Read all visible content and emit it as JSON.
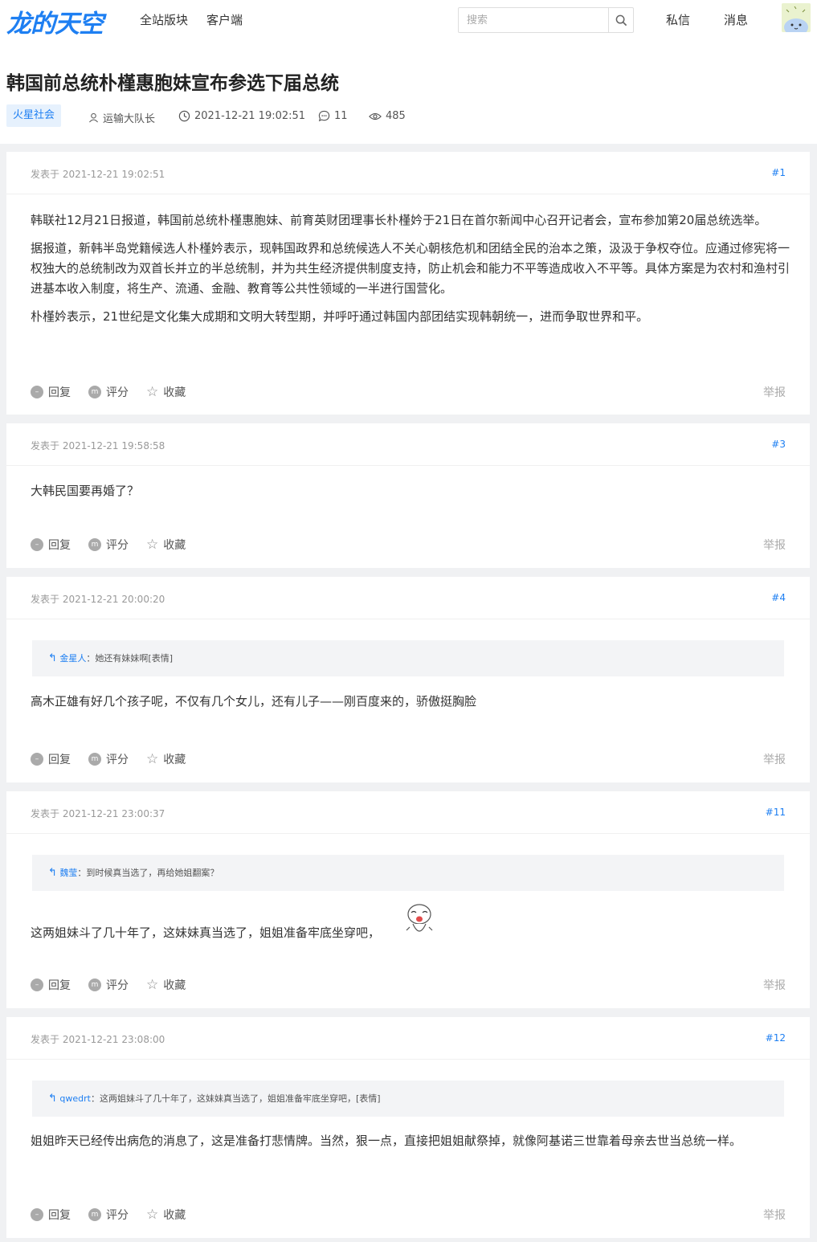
{
  "header": {
    "logo": "龙的天空",
    "nav": [
      "全站版块",
      "客户端"
    ],
    "search_placeholder": "搜索",
    "links": [
      "私信",
      "消息"
    ]
  },
  "thread": {
    "title": "韩国前总统朴槿惠胞妹宣布参选下届总统",
    "tag": "火星社会",
    "author": "运输大队长",
    "time": "2021-12-21 19:02:51",
    "replies": "11",
    "views": "485"
  },
  "labels": {
    "reply": "回复",
    "rate": "评分",
    "favorite": "收藏",
    "report": "举报"
  },
  "posts": [
    {
      "posted": "发表于 2021-12-21 19:02:51",
      "floor": "#1",
      "paragraphs": [
        "韩联社12月21日报道，韩国前总统朴槿惠胞妹、前育英财团理事长朴槿妗于21日在首尔新闻中心召开记者会，宣布参加第20届总统选举。",
        "据报道，新韩半岛党籍候选人朴槿妗表示，现韩国政界和总统候选人不关心朝核危机和团结全民的治本之策，汲汲于争权夺位。应通过修宪将一权独大的总统制改为双首长并立的半总统制，并为共生经济提供制度支持，防止机会和能力不平等造成收入不平等。具体方案是为农村和渔村引进基本收入制度，将生产、流通、金融、教育等公共性领域的一半进行国营化。",
        "朴槿妗表示，21世纪是文化集大成期和文明大转型期，并呼吁通过韩国内部团结实现韩朝统一，进而争取世界和平。"
      ]
    },
    {
      "posted": "发表于 2021-12-21 19:58:58",
      "floor": "#3",
      "paragraphs": [
        "大韩民国要再婚了？"
      ]
    },
    {
      "posted": "发表于 2021-12-21 20:00:20",
      "floor": "#4",
      "quote_user": "金星人",
      "quote_text": "：她还有妹妹啊[表情]",
      "paragraphs": [
        "高木正雄有好几个孩子呢，不仅有几个女儿，还有儿子——刚百度来的，骄傲挺胸脸"
      ]
    },
    {
      "posted": "发表于 2021-12-21 23:00:37",
      "floor": "#11",
      "quote_user": "魏莹",
      "quote_text": "：到时候真当选了，再给她姐翻案？",
      "paragraphs": [
        "这两姐妹斗了几十年了，这妹妹真当选了，姐姐准备牢底坐穿吧，"
      ]
    },
    {
      "posted": "发表于 2021-12-21 23:08:00",
      "floor": "#12",
      "quote_user": "qwedrt",
      "quote_text": "：这两姐妹斗了几十年了，这妹妹真当选了，姐姐准备牢底坐穿吧，[表情]",
      "paragraphs": [
        "姐姐昨天已经传出病危的消息了，这是准备打悲情牌。当然，狠一点，直接把姐姐献祭掉，就像阿基诺三世靠着母亲去世当总统一样。"
      ]
    }
  ]
}
